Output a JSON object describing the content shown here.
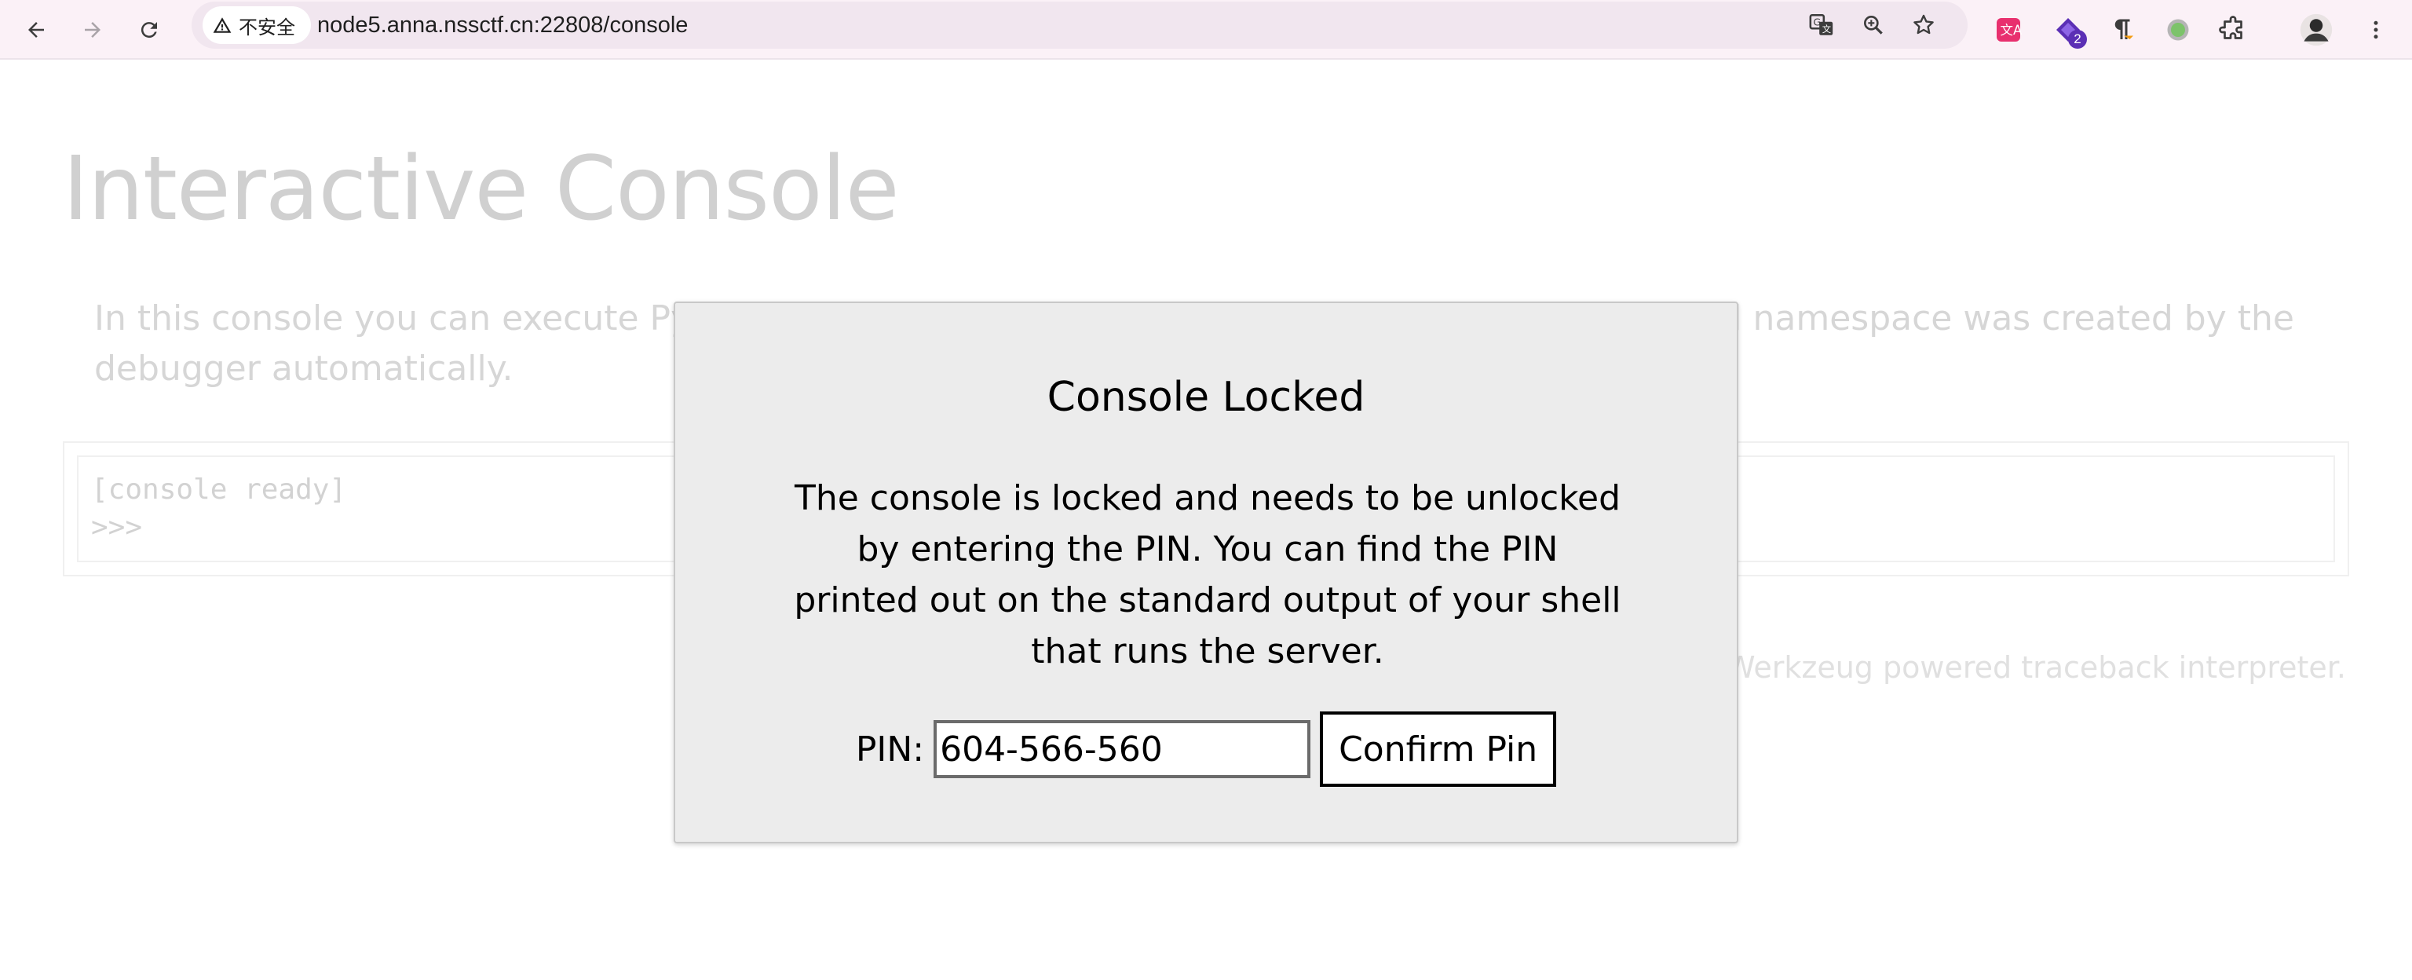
{
  "browser": {
    "security_label": "不安全",
    "url": "node5.anna.nssctf.cn:22808/console",
    "extensions": [
      {
        "icon": "translate-extension-icon"
      },
      {
        "icon": "diamond-extension-icon",
        "badge": "2"
      },
      {
        "icon": "pilcrow-extension-icon"
      },
      {
        "icon": "circle-extension-icon"
      },
      {
        "icon": "puzzle-extensions-icon"
      }
    ]
  },
  "page": {
    "title": "Interactive Console",
    "intro": "In this console you can execute Python expressions in the context of the application. The initial namespace was created by the debugger automatically.",
    "console_ready": "[console ready]",
    "console_prompt": ">>>",
    "footer": "Brought to you by DON'T PANIC, your friendly Werkzeug powered traceback interpreter."
  },
  "modal": {
    "title": "Console Locked",
    "text": "The console is locked and needs to be unlocked by entering the PIN. You can find the PIN printed out on the standard output of your shell that runs the server.",
    "pin_label": "PIN:",
    "pin_value": "604-566-560",
    "button_label": "Confirm Pin"
  },
  "colors": {
    "toolbar_bg": "#fbf1f7",
    "omnibox_bg": "#f1e6ef",
    "modal_bg": "#ececec",
    "dimmed_text": "#d0d0d0"
  }
}
